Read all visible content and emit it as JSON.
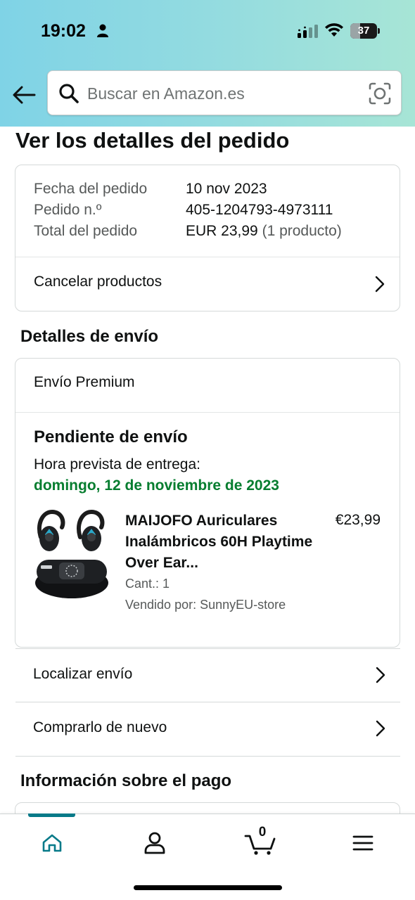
{
  "status_bar": {
    "time": "19:02",
    "battery": "37",
    "battery_fraction": 0.37
  },
  "search": {
    "placeholder": "Buscar en Amazon.es",
    "value": ""
  },
  "page": {
    "title": "Ver los detalles del pedido"
  },
  "order_summary": {
    "rows": [
      {
        "label": "Fecha del pedido",
        "value": "10 nov 2023",
        "extra": ""
      },
      {
        "label": "Pedido n.º",
        "value": "405-1204793-4973111",
        "extra": ""
      },
      {
        "label": "Total del pedido",
        "value": "EUR 23,99",
        "extra": "(1 producto)"
      }
    ],
    "cancel_label": "Cancelar productos"
  },
  "shipping": {
    "section_title": "Detalles de envío",
    "shipping_type": "Envío Premium",
    "status": "Pendiente de envío",
    "eta_label": "Hora prevista de entrega:",
    "eta_date": "domingo, 12 de noviembre de 2023",
    "product": {
      "title": "MAIJOFO Auriculares Inalámbricos 60H Playtime Over Ear...",
      "price": "€23,99",
      "quantity": "Cant.: 1",
      "seller": "Vendido por: SunnyEU-store"
    },
    "track_label": "Localizar envío",
    "buy_again_label": "Comprarlo de nuevo"
  },
  "payment": {
    "section_title": "Información sobre el pago"
  },
  "bottom_nav": {
    "cart_count": "0",
    "items": [
      {
        "name": "home",
        "icon": "home-icon",
        "active": true
      },
      {
        "name": "account",
        "icon": "person-icon",
        "active": false
      },
      {
        "name": "cart",
        "icon": "cart-icon",
        "active": false
      },
      {
        "name": "menu",
        "icon": "menu-icon",
        "active": false
      }
    ]
  },
  "colors": {
    "accent": "#077a89",
    "delivery_green": "#067d2f",
    "header_gradient_start": "#7fd3e6",
    "header_gradient_end": "#a7e5d6"
  }
}
